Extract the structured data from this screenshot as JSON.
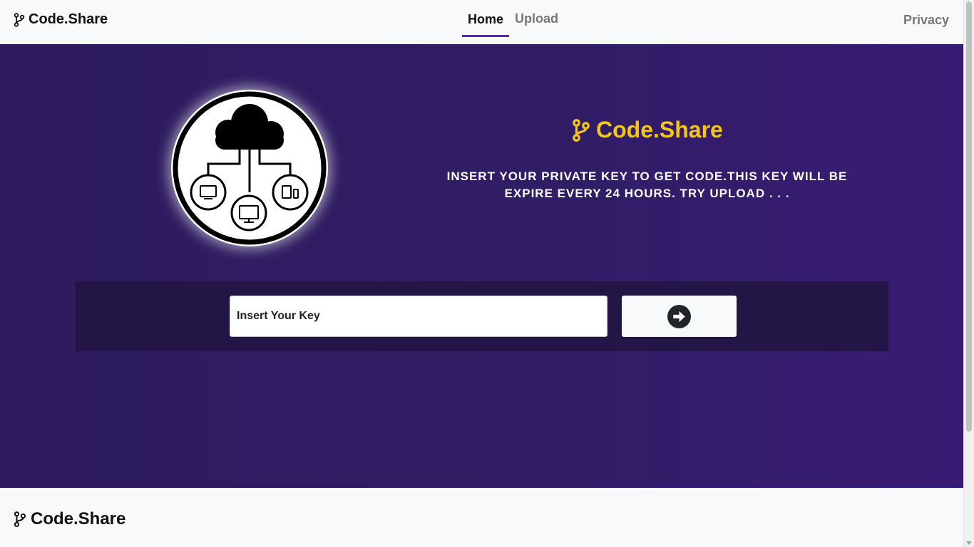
{
  "navbar": {
    "brand": "Code.Share",
    "links": [
      {
        "label": "Home",
        "active": true
      },
      {
        "label": "Upload",
        "active": false
      }
    ],
    "privacy": "Privacy"
  },
  "hero": {
    "logo_icon": "cloud-network-icon",
    "title": "Code.Share",
    "description": "INSERT YOUR PRIVATE KEY TO GET CODE.THIS KEY WILL BE EXPIRE EVERY 24 HOURS. TRY UPLOAD . . ."
  },
  "key_form": {
    "placeholder": "Insert Your Key",
    "value": "",
    "submit_icon": "arrow-right-circle-icon"
  },
  "footer": {
    "brand": "Code.Share"
  },
  "colors": {
    "hero_bg": "#301d66",
    "panel_bg": "#231545",
    "accent_yellow": "#f5c518",
    "active_underline": "#5b1fd1"
  }
}
